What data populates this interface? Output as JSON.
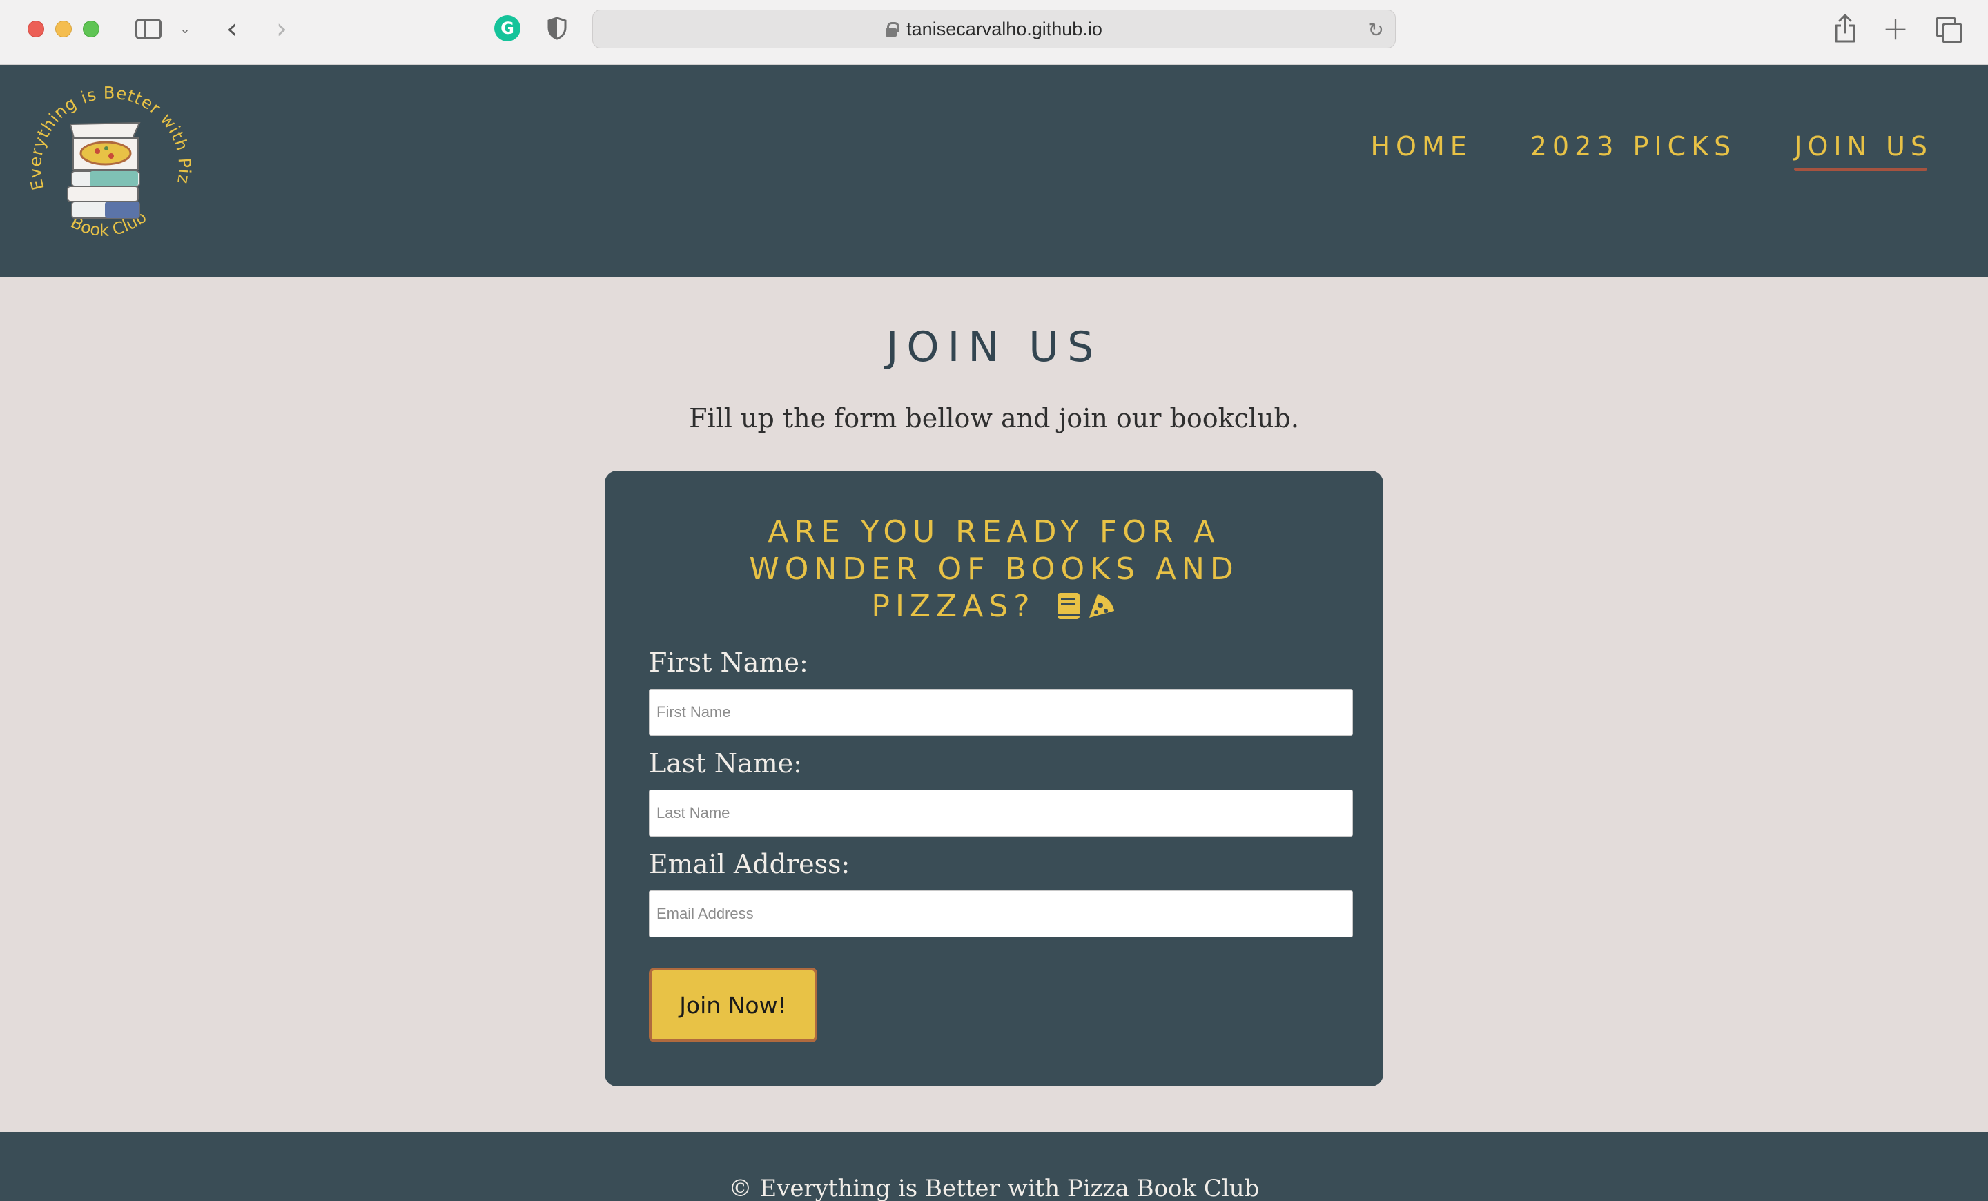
{
  "browser": {
    "url": "tanisecarvalho.github.io"
  },
  "site": {
    "logo_text_top": "Everything is Better with Pizza",
    "logo_text_bottom": "Book Club",
    "nav": [
      {
        "label": "HOME",
        "active": false
      },
      {
        "label": "2023 PICKS",
        "active": false
      },
      {
        "label": "JOIN US",
        "active": true
      }
    ],
    "colors": {
      "header_bg": "#3a4d56",
      "accent": "#e8c246",
      "page_bg": "#e3dcda",
      "underline": "#a6533f"
    }
  },
  "main": {
    "title": "JOIN US",
    "subtitle": "Fill up the form bellow and join our bookclub.",
    "form": {
      "heading_line1": "ARE YOU READY FOR A",
      "heading_line2": "WONDER OF BOOKS AND",
      "heading_line3": "PIZZAS?",
      "heading_icons": [
        "book-icon",
        "pizza-icon"
      ],
      "first_name_label": "First Name:",
      "first_name_placeholder": "First Name",
      "last_name_label": "Last Name:",
      "last_name_placeholder": "Last Name",
      "email_label": "Email Address:",
      "email_placeholder": "Email Address",
      "submit_label": "Join Now!"
    }
  },
  "footer": {
    "text": "© Everything is Better with Pizza Book Club"
  }
}
